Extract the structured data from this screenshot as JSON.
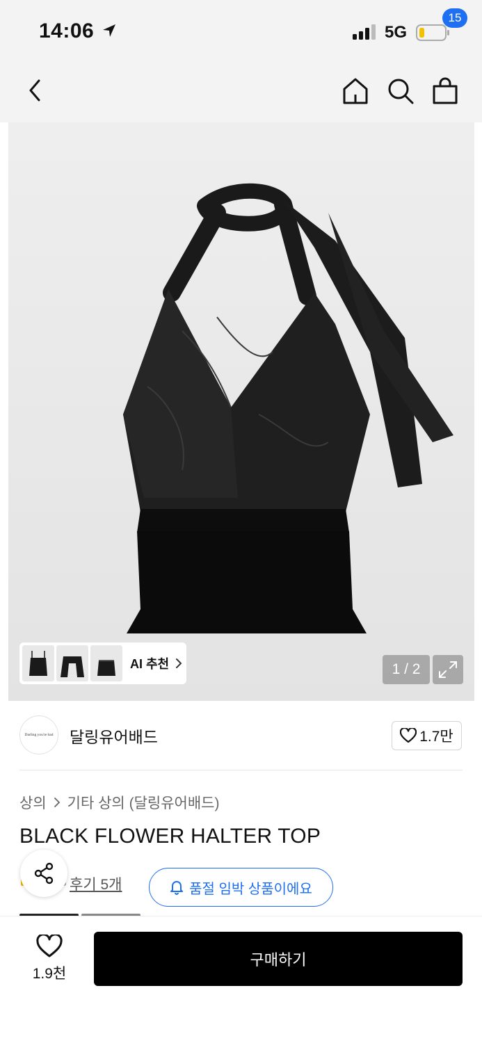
{
  "status_bar": {
    "time": "14:06",
    "network": "5G",
    "battery_level": 0.2
  },
  "nav": {
    "cart_count": "15"
  },
  "hero": {
    "ai_recommend_label": "AI 추천",
    "pager": "1 / 2"
  },
  "brand": {
    "logo_text": "Darling you're bad",
    "name": "달링유어배드",
    "like_count": "1.7만"
  },
  "product": {
    "breadcrumb": [
      "상의",
      "기타 상의 (달링유어배드)"
    ],
    "title": "BLACK FLOWER HALTER TOP",
    "review_link": "후기 5개",
    "soldout_notice": "품절 임박 상품이에요"
  },
  "bottom": {
    "like_count": "1.9천",
    "buy_label": "구매하기"
  },
  "colors": {
    "accent": "#1e6ff1",
    "buy_button": "#000000",
    "badge": "#1e6ff1"
  }
}
